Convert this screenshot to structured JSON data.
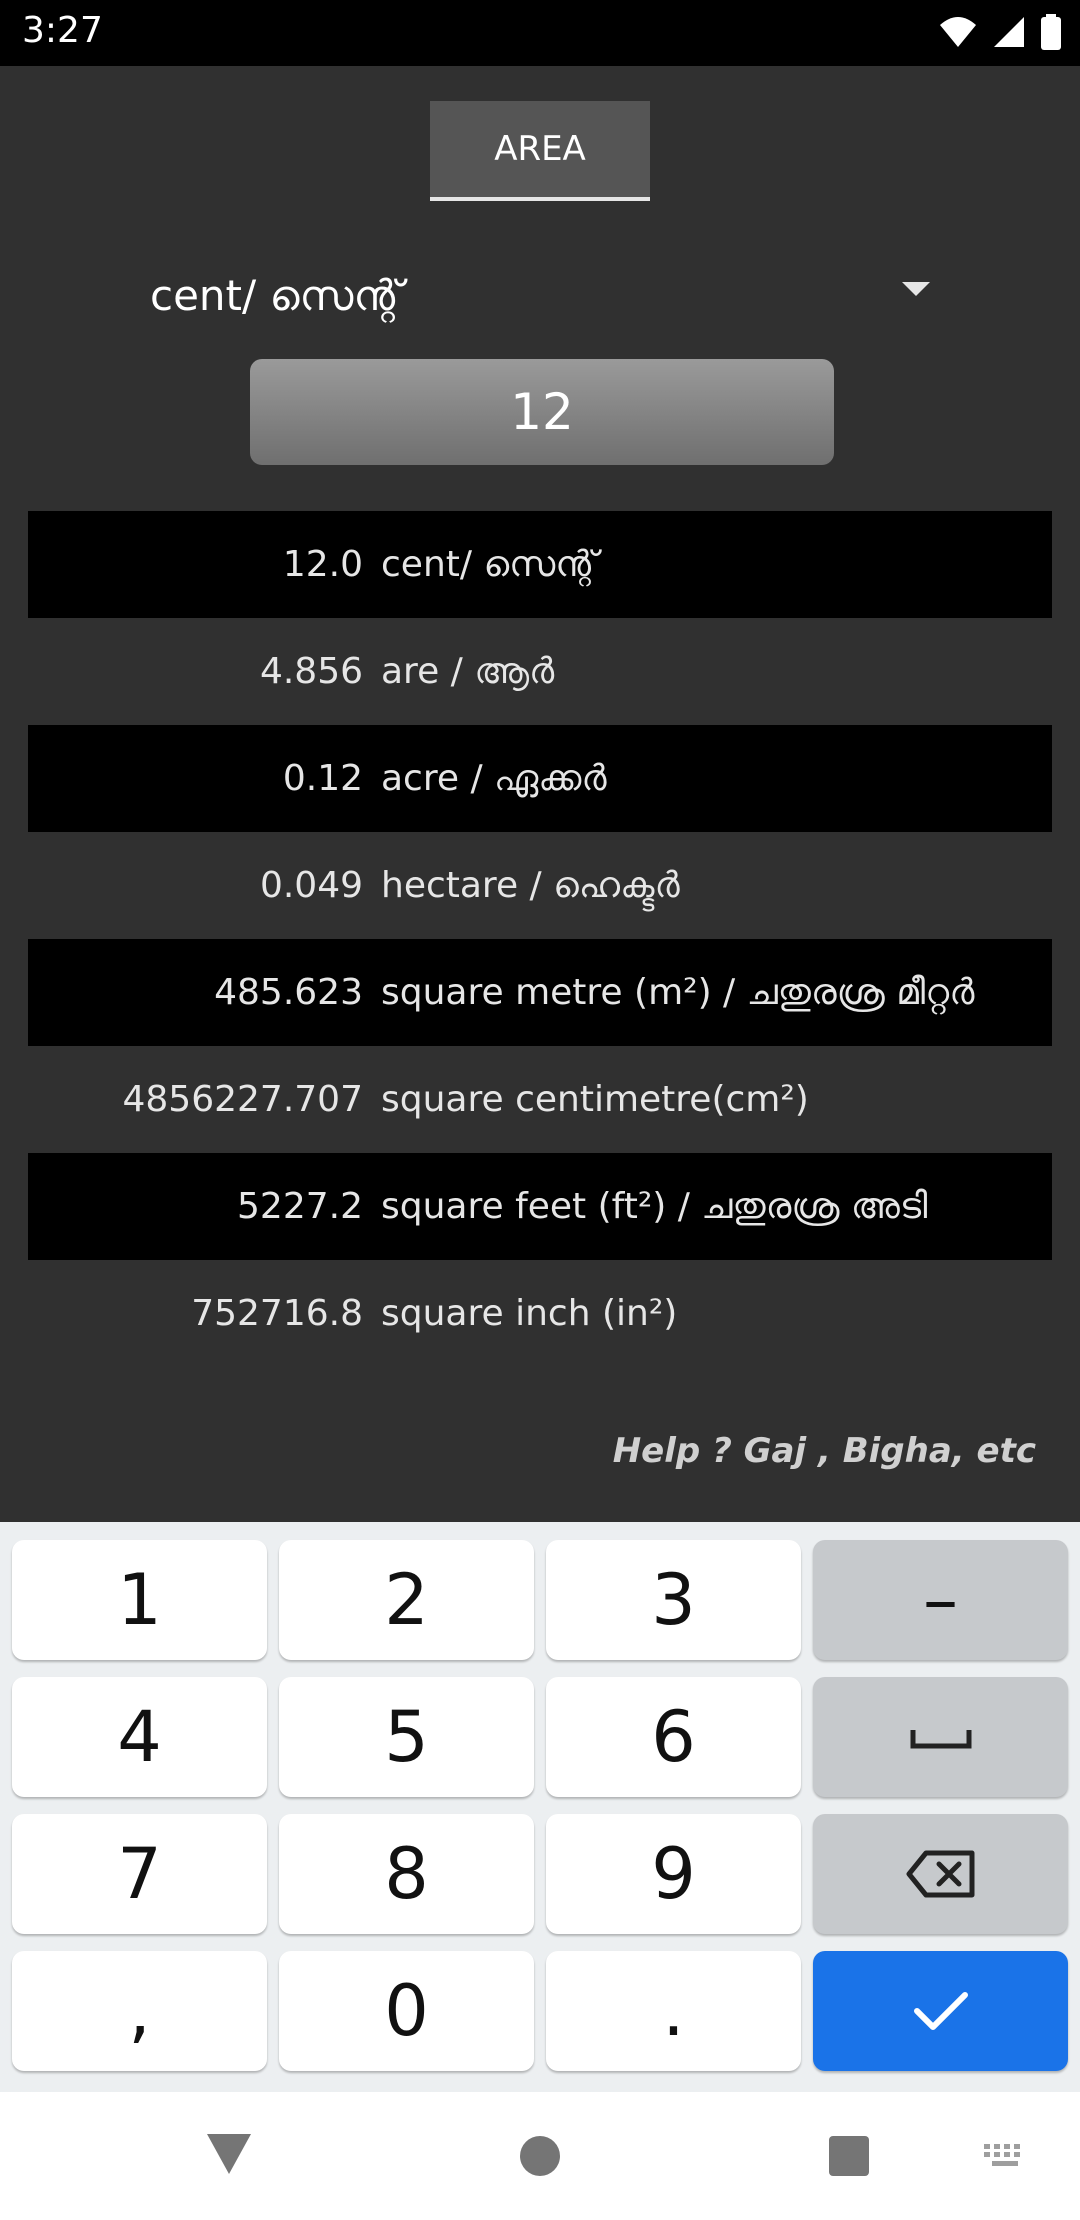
{
  "status": {
    "time": "3:27"
  },
  "tab": {
    "label": "AREA"
  },
  "unit_select": {
    "value": "cent/ സെന്റ്"
  },
  "input": {
    "value": "12"
  },
  "results": [
    {
      "value": "12.0",
      "unit": "cent/ സെന്റ്"
    },
    {
      "value": "4.856",
      "unit": "are / ആർ"
    },
    {
      "value": "0.12",
      "unit": "acre / ഏക്കർ"
    },
    {
      "value": "0.049",
      "unit": "hectare / ഹെക്ടർ"
    },
    {
      "value": "485.623",
      "unit": "square metre (m²) / ചതുരശ്ര മീറ്റർ"
    },
    {
      "value": "4856227.707",
      "unit": "square centimetre(cm²)"
    },
    {
      "value": "5227.2",
      "unit": "square feet (ft²) / ചതുരശ്ര അടി"
    },
    {
      "value": "752716.8",
      "unit": "square inch (in²)"
    }
  ],
  "help": {
    "text": "Help ?  Gaj , Bigha, etc"
  },
  "keyboard": {
    "k1": "1",
    "k2": "2",
    "k3": "3",
    "minus": "–",
    "k4": "4",
    "k5": "5",
    "k6": "6",
    "k7": "7",
    "k8": "8",
    "k9": "9",
    "comma": ",",
    "k0": "0",
    "dot": "."
  },
  "colors": {
    "accent": "#1a73e8",
    "background": "#303030",
    "row_dark": "#000000"
  }
}
